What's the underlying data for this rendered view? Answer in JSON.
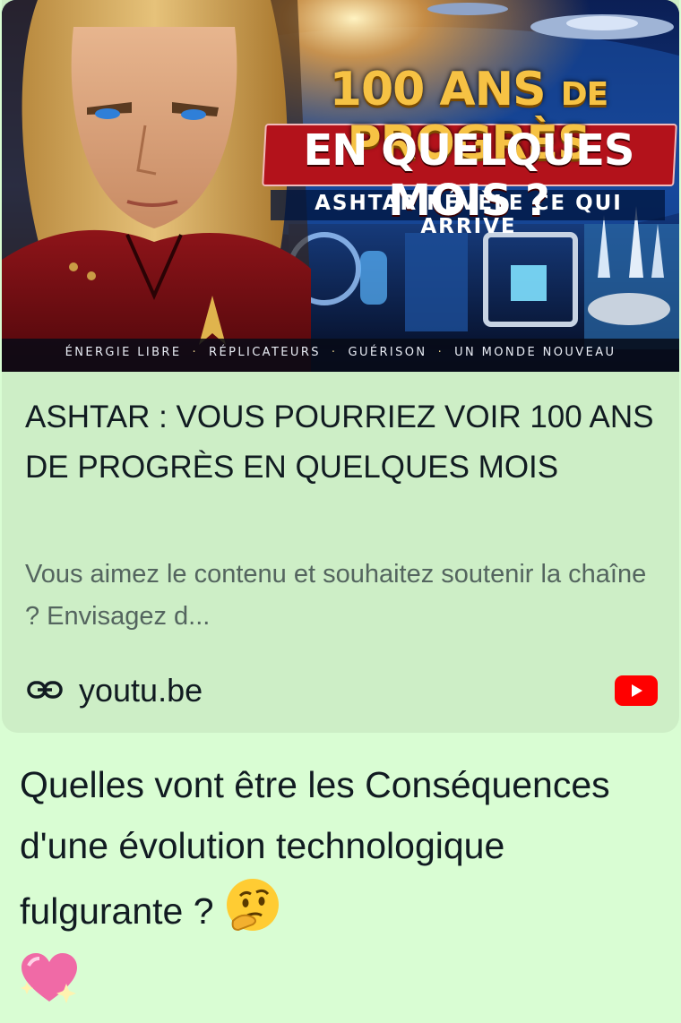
{
  "preview": {
    "thumbnail": {
      "headline_1_big": "100 ANS ",
      "headline_1_small": "DE",
      "headline_1_end": " PROGRÈS",
      "headline_2": "EN QUELQUES MOIS ?",
      "headline_3": "ASHTAR RÉVÈLE CE QUI ARRIVE",
      "tags": [
        "ÉNERGIE LIBRE",
        "RÉPLICATEURS",
        "GUÉRISON",
        "UN MONDE NOUVEAU"
      ],
      "tag_separator": "·"
    },
    "title": "ASHTAR : VOUS POURRIEZ VOIR 100 ANS DE PROGRÈS EN QUELQUES MOIS",
    "description": "Vous aimez le contenu et souhaitez soutenir la chaîne ? Envisagez d...",
    "domain": "youtu.be",
    "link_icon": "link-icon",
    "source_icon": "youtube-icon"
  },
  "message": {
    "text": "Quelles vont être les Conséquences d'une évolution technologique fulgurante ? ",
    "emoji_1": "thinking-face-emoji",
    "emoji_2": "sparkling-heart-emoji"
  },
  "colors": {
    "bubble": "#d9fdd3",
    "card": "#cdeec6",
    "youtube_red": "#ff0000"
  }
}
